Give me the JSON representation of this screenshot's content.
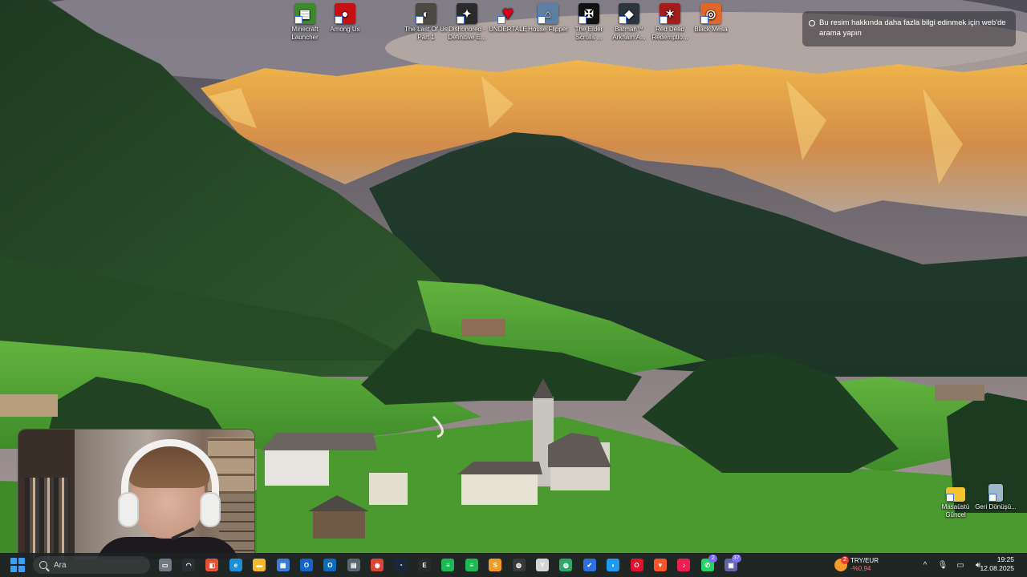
{
  "desktop_icons": [
    {
      "label": "Minecraft Launcher",
      "icon": "minecraft-icon",
      "color": "#3c8a2e",
      "glyph": "▦"
    },
    {
      "label": "Among Us",
      "icon": "among-us-icon",
      "color": "#c51111",
      "glyph": "●"
    },
    {
      "label": "The Last Of Us Part 1",
      "icon": "the-last-of-us-icon",
      "color": "#4a4a42",
      "glyph": "◐"
    },
    {
      "label": "Dishonored - Definitive E...",
      "icon": "dishonored-icon",
      "color": "#2b2b2b",
      "glyph": "✦"
    },
    {
      "label": "UNDERTALE",
      "icon": "undertale-heart-icon",
      "color": "#000000",
      "glyph": "♥"
    },
    {
      "label": "House Flipper",
      "icon": "house-flipper-icon",
      "color": "#5d7fa3",
      "glyph": "⌂"
    },
    {
      "label": "The Elder Scrolls ...",
      "icon": "elder-scrolls-icon",
      "color": "#111111",
      "glyph": "✠"
    },
    {
      "label": "Batman™ Arkham A...",
      "icon": "batman-icon",
      "color": "#2c3440",
      "glyph": "◆"
    },
    {
      "label": "Red Dead Redemptio...",
      "icon": "red-dead-icon",
      "color": "#a31b1b",
      "glyph": "✶"
    },
    {
      "label": "Black Mesa",
      "icon": "black-mesa-icon",
      "color": "#e0672a",
      "glyph": "◎"
    }
  ],
  "lens_tooltip": {
    "text": "Bu resim hakkında daha fazla bilgi edinmek için web'de arama yapın"
  },
  "right_icons": [
    {
      "label": "Masaüstü Güncel",
      "icon": "folder-icon",
      "color": "#f4c430"
    },
    {
      "label": "Geri Dönüşü...",
      "icon": "recycle-bin-icon",
      "color": "#9fb7c8"
    }
  ],
  "taskbar": {
    "search_placeholder": "Ara",
    "apps": [
      {
        "name": "task-view",
        "icon": "task-view-icon",
        "color": "#6f7b83",
        "glyph": "▭",
        "badge": ""
      },
      {
        "name": "copilot",
        "icon": "copilot-icon",
        "color": "#2a2f33",
        "glyph": "◠",
        "badge": ""
      },
      {
        "name": "widgets-app",
        "icon": "colorful-app-icon",
        "color": "#e2533a",
        "glyph": "◧",
        "badge": ""
      },
      {
        "name": "edge",
        "icon": "edge-icon",
        "color": "#1c8fd6",
        "glyph": "e",
        "badge": ""
      },
      {
        "name": "file-explorer",
        "icon": "folder-icon",
        "color": "#f2b930",
        "glyph": "▬",
        "badge": ""
      },
      {
        "name": "store",
        "icon": "store-icon",
        "color": "#3a7bd5",
        "glyph": "▦",
        "badge": ""
      },
      {
        "name": "outlook",
        "icon": "outlook-icon",
        "color": "#1366c7",
        "glyph": "O",
        "badge": ""
      },
      {
        "name": "outlook-new",
        "icon": "outlook-new-icon",
        "color": "#0f6cbd",
        "glyph": "O",
        "badge": ""
      },
      {
        "name": "calculator",
        "icon": "calculator-icon",
        "color": "#5b6770",
        "glyph": "▤",
        "badge": ""
      },
      {
        "name": "chrome",
        "icon": "chrome-icon",
        "color": "#db4437",
        "glyph": "◉",
        "badge": ""
      },
      {
        "name": "steam",
        "icon": "steam-icon",
        "color": "#1b2838",
        "glyph": "◔",
        "badge": ""
      },
      {
        "name": "epic",
        "icon": "epic-games-icon",
        "color": "#2a2a2a",
        "glyph": "E",
        "badge": ""
      },
      {
        "name": "spotify",
        "icon": "spotify-icon",
        "color": "#1db954",
        "glyph": "≡",
        "badge": ""
      },
      {
        "name": "spotify-2",
        "icon": "spotify-icon",
        "color": "#1db954",
        "glyph": "≡",
        "badge": ""
      },
      {
        "name": "sublime",
        "icon": "sublime-icon",
        "color": "#f29a26",
        "glyph": "S",
        "badge": ""
      },
      {
        "name": "obs",
        "icon": "obs-icon",
        "color": "#3a3a3a",
        "glyph": "◍",
        "badge": ""
      },
      {
        "name": "game-app",
        "icon": "game-icon",
        "color": "#d5d5d5",
        "glyph": "Y",
        "badge": ""
      },
      {
        "name": "globe",
        "icon": "globe-icon",
        "color": "#2fa86a",
        "glyph": "◍",
        "badge": ""
      },
      {
        "name": "todo",
        "icon": "todo-check-icon",
        "color": "#2f6fe0",
        "glyph": "✔",
        "badge": ""
      },
      {
        "name": "bird",
        "icon": "bird-icon",
        "color": "#1d9bf0",
        "glyph": "◗",
        "badge": ""
      },
      {
        "name": "opera",
        "icon": "opera-icon",
        "color": "#e0112b",
        "glyph": "O",
        "badge": ""
      },
      {
        "name": "brave",
        "icon": "brave-icon",
        "color": "#fb542b",
        "glyph": "▼",
        "badge": ""
      },
      {
        "name": "tiktok",
        "icon": "tiktok-icon",
        "color": "#ee1d52",
        "glyph": "♪",
        "badge": ""
      },
      {
        "name": "whatsapp",
        "icon": "whatsapp-icon",
        "color": "#25d366",
        "glyph": "✆",
        "badge": "2"
      },
      {
        "name": "chat-app",
        "icon": "chat-icon",
        "color": "#6264a7",
        "glyph": "▣",
        "badge": "37"
      }
    ]
  },
  "currency_widget": {
    "pair": "TRY/EUR",
    "change": "-%0,94",
    "badge": "2"
  },
  "tray": {
    "chevron": "^",
    "mic": "mic-icon",
    "display": "display-icon",
    "volume": "volume-icon"
  },
  "clock": {
    "time": "19:25",
    "date": "12.08.2025"
  },
  "colors": {
    "taskbar_bg": "#1e2224",
    "accent": "#3aa0ff",
    "negative": "#ff6b6b"
  }
}
